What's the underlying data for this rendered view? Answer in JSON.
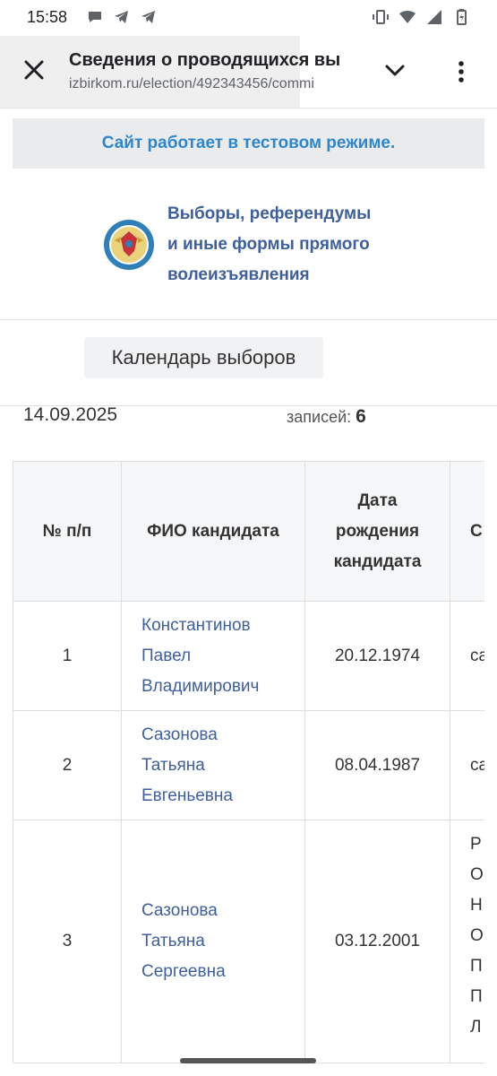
{
  "status_bar": {
    "time": "15:58",
    "notification_icons": [
      "chat-bubble-icon",
      "telegram-icon",
      "telegram-icon"
    ],
    "system_icons": [
      "vibrate-icon",
      "wifi-icon",
      "signal-icon",
      "battery-icon"
    ]
  },
  "browser": {
    "page_title": "Сведения о проводящихся вы",
    "url": "izbirkom.ru/election/492343456/commi"
  },
  "banner": {
    "text": "Сайт работает в тестовом режиме."
  },
  "logo": {
    "line1": "Выборы, референдумы",
    "line2": "и иные формы прямого",
    "line3": "волеизъявления"
  },
  "calendar_button": {
    "label": "Календарь выборов"
  },
  "summary": {
    "date": "14.09.2025",
    "records_label": "записей:",
    "records_count": "6"
  },
  "table": {
    "headers": {
      "num": "№ п/п",
      "fio": "ФИО кандидата",
      "dob_line1": "Дата",
      "dob_line2": "рождения",
      "dob_line3": "кандидата",
      "extra": "С"
    },
    "rows": [
      {
        "num": "1",
        "fio_line1": "Константинов",
        "fio_line2": "Павел",
        "fio_line3": "Владимирович",
        "dob": "20.12.1974",
        "extra": [
          "са"
        ]
      },
      {
        "num": "2",
        "fio_line1": "Сазонова",
        "fio_line2": "Татьяна",
        "fio_line3": "Евгеньевна",
        "dob": "08.04.1987",
        "extra": [
          "са"
        ]
      },
      {
        "num": "3",
        "fio_line1": "Сазонова",
        "fio_line2": "Татьяна",
        "fio_line3": "Сергеевна",
        "dob": "03.12.2001",
        "extra": [
          "Р",
          "О",
          "Н",
          "О",
          "П",
          "П",
          "Л"
        ]
      }
    ]
  },
  "colors": {
    "link": "#3e5f9c",
    "banner_text": "#2f87c9",
    "banner_bg": "#e9ebed"
  }
}
